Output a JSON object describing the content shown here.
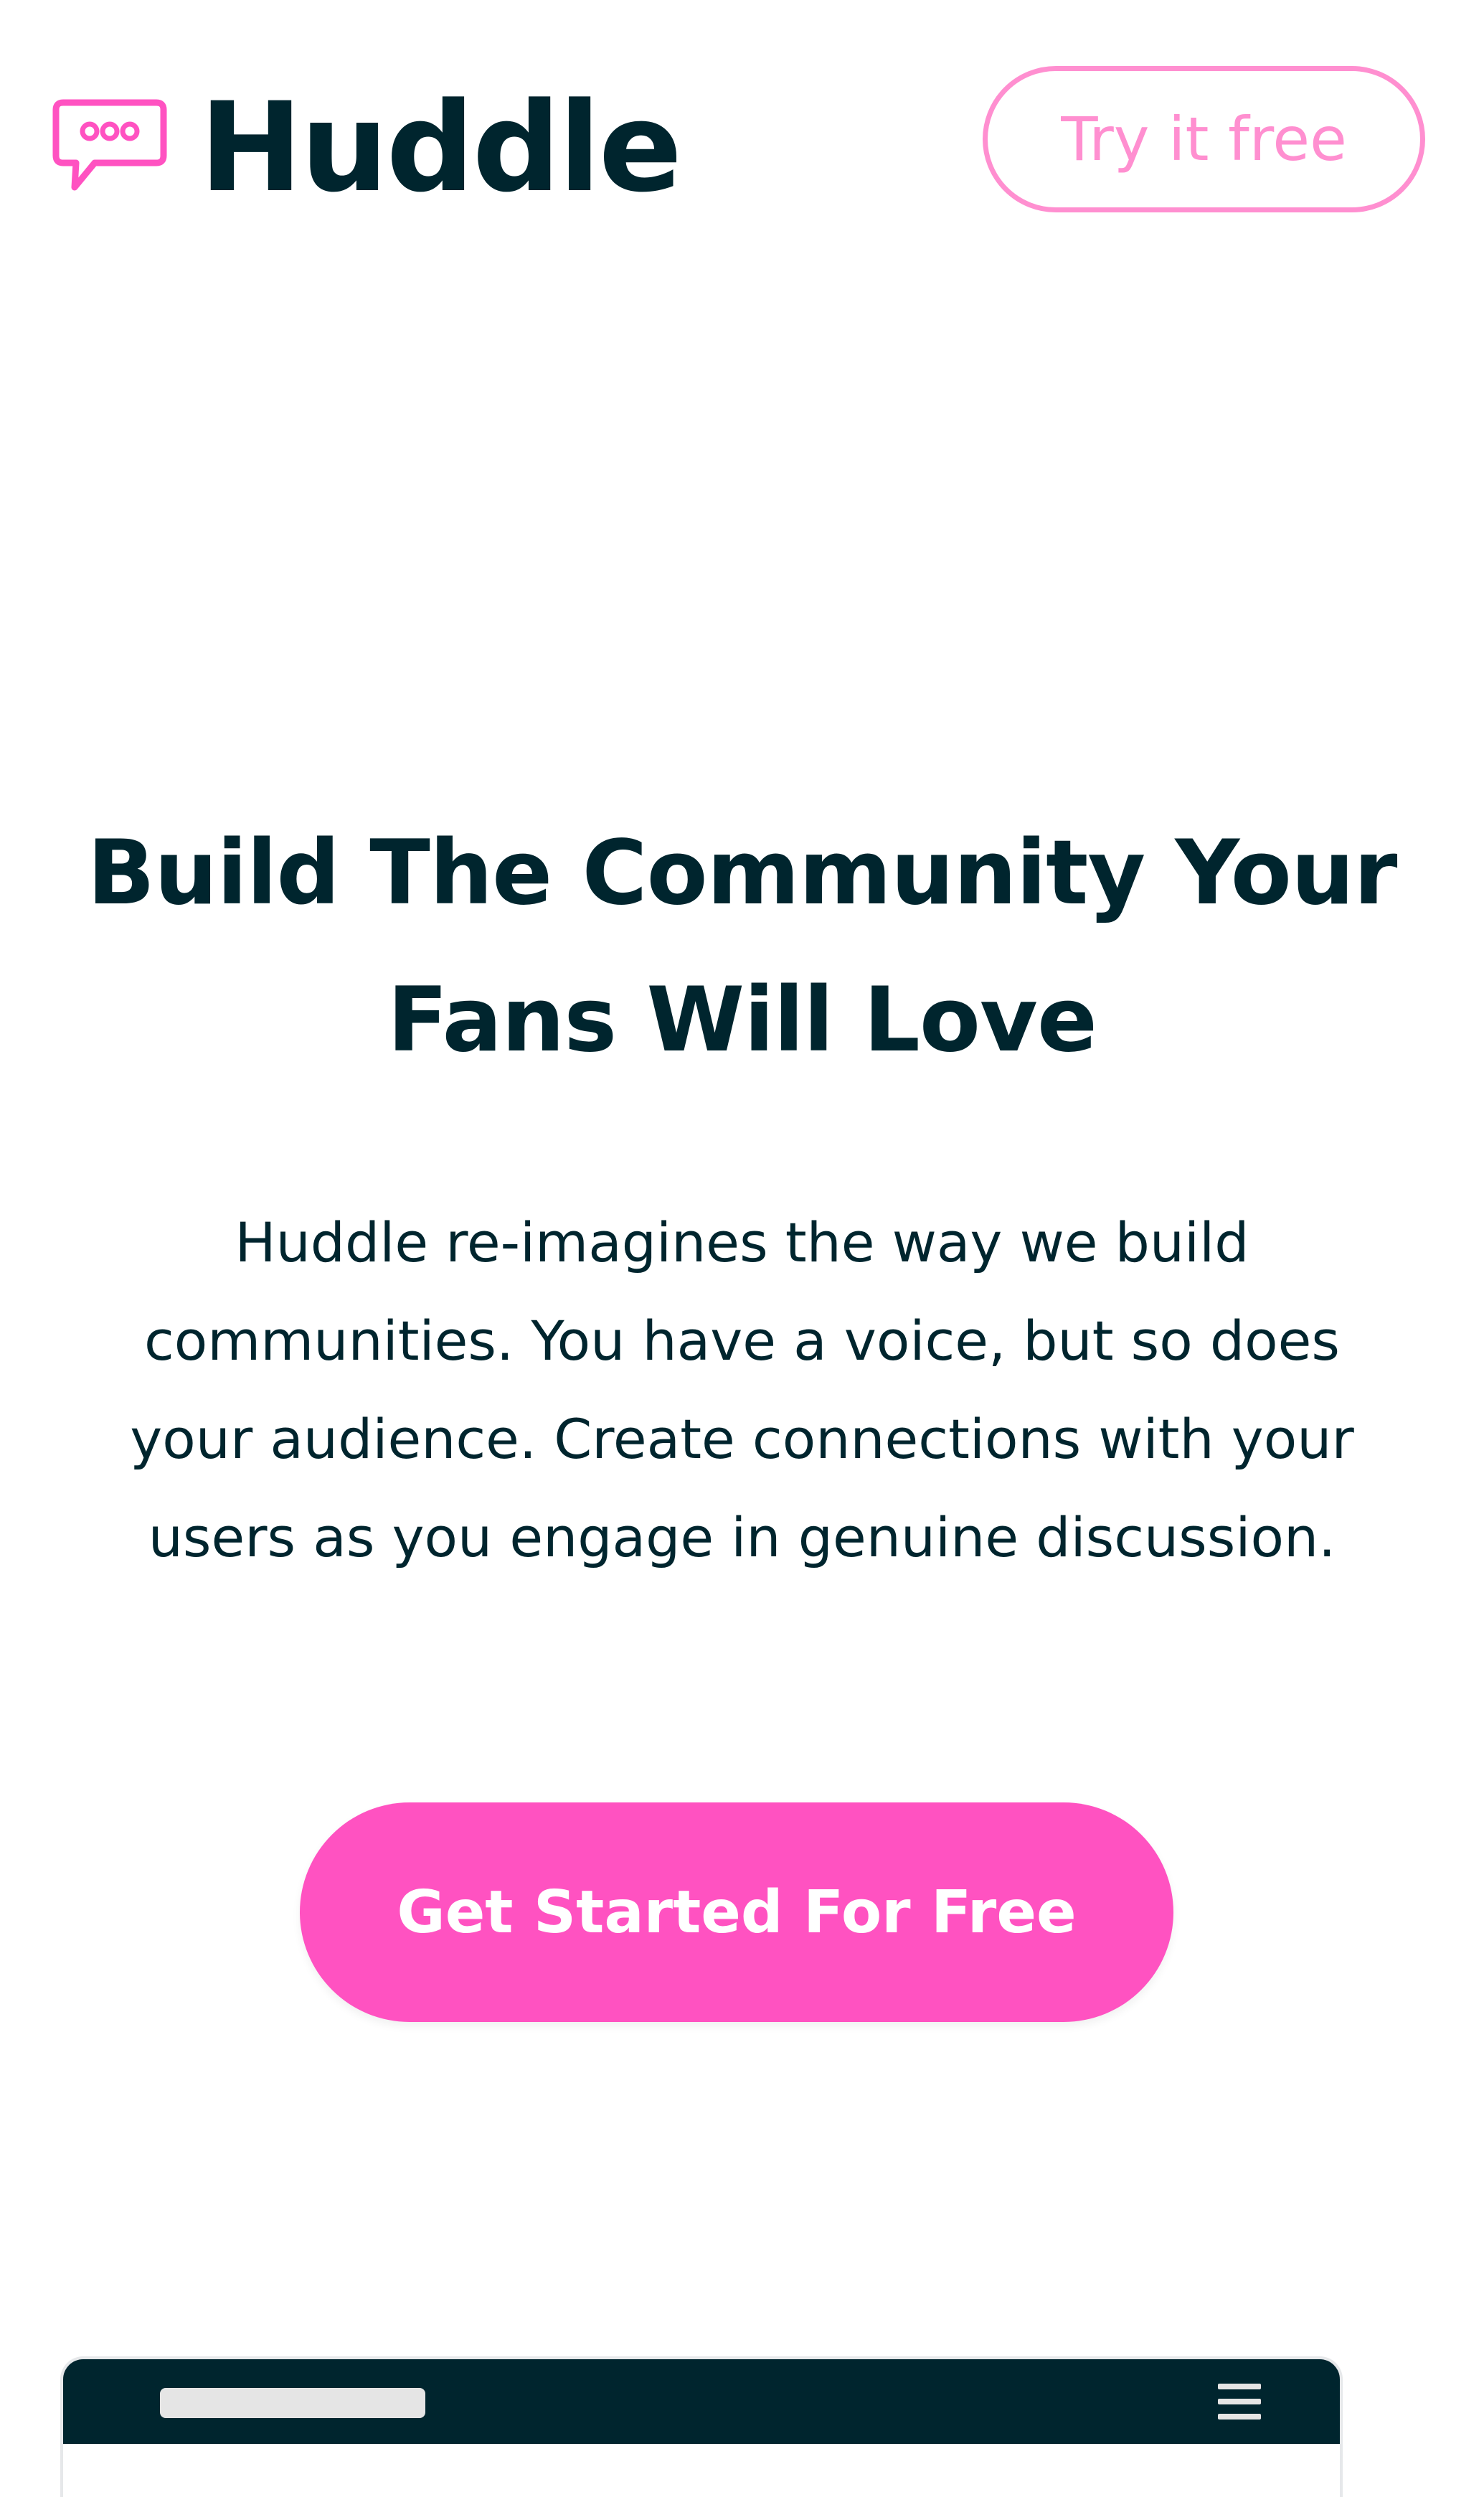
{
  "header": {
    "brand_name": "Huddle",
    "logo_icon": "chat-bubble-icon",
    "try_button_label": "Try it free"
  },
  "hero": {
    "title": "Build The Community Your Fans Will Love",
    "description": "Huddle re-imagines the way we build communities. You have a voice, but so does your audience. Create connections with your users as you engage in genuine discussion.",
    "cta_label": "Get Started For Free"
  },
  "mockup": {
    "menu_icon": "hamburger-menu-icon"
  },
  "colors": {
    "brand_dark": "#00252e",
    "accent_pink": "#ff52c1",
    "outline_pink": "#ff8fd0",
    "background": "#ffffff"
  }
}
